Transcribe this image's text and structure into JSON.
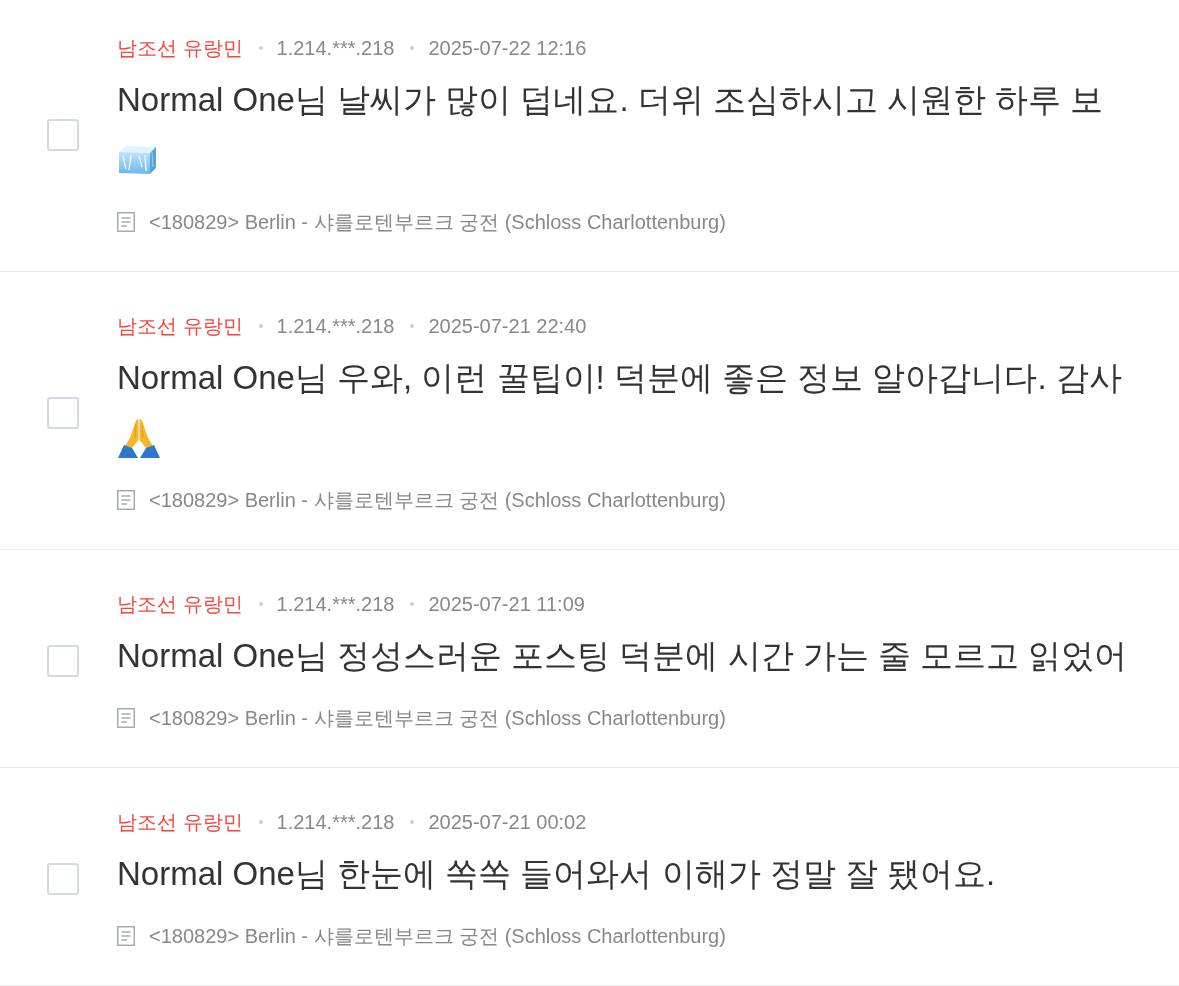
{
  "comments": [
    {
      "checked": false,
      "author": "남조선 유랑민",
      "ip": "1.214.***.218",
      "date": "2025-07-22 12:16",
      "text": "Normal One님 날씨가 많이 덥네요. 더위 조심하시고 시원한 하루 보",
      "emoji": {
        "kind": "ice_cube"
      },
      "post": "<180829> Berlin - 샤를로텐부르크 궁전 (Schloss Charlottenburg)"
    },
    {
      "checked": false,
      "author": "남조선 유랑민",
      "ip": "1.214.***.218",
      "date": "2025-07-21 22:40",
      "text": "Normal One님 우와, 이런 꿀팁이! 덕분에 좋은 정보 알아갑니다. 감사",
      "emoji": {
        "kind": "praying_hands"
      },
      "post": "<180829> Berlin - 샤를로텐부르크 궁전 (Schloss Charlottenburg)"
    },
    {
      "checked": false,
      "author": "남조선 유랑민",
      "ip": "1.214.***.218",
      "date": "2025-07-21 11:09",
      "text": "Normal One님 정성스러운 포스팅 덕분에 시간 가는 줄 모르고 읽었어",
      "post": "<180829> Berlin - 샤를로텐부르크 궁전 (Schloss Charlottenburg)"
    },
    {
      "checked": false,
      "author": "남조선 유랑민",
      "ip": "1.214.***.218",
      "date": "2025-07-21 00:02",
      "text": "Normal One님 한눈에 쏙쏙 들어와서 이해가 정말 잘 됐어요.",
      "post": "<180829> Berlin - 샤를로텐부르크 궁전 (Schloss Charlottenburg)"
    }
  ]
}
